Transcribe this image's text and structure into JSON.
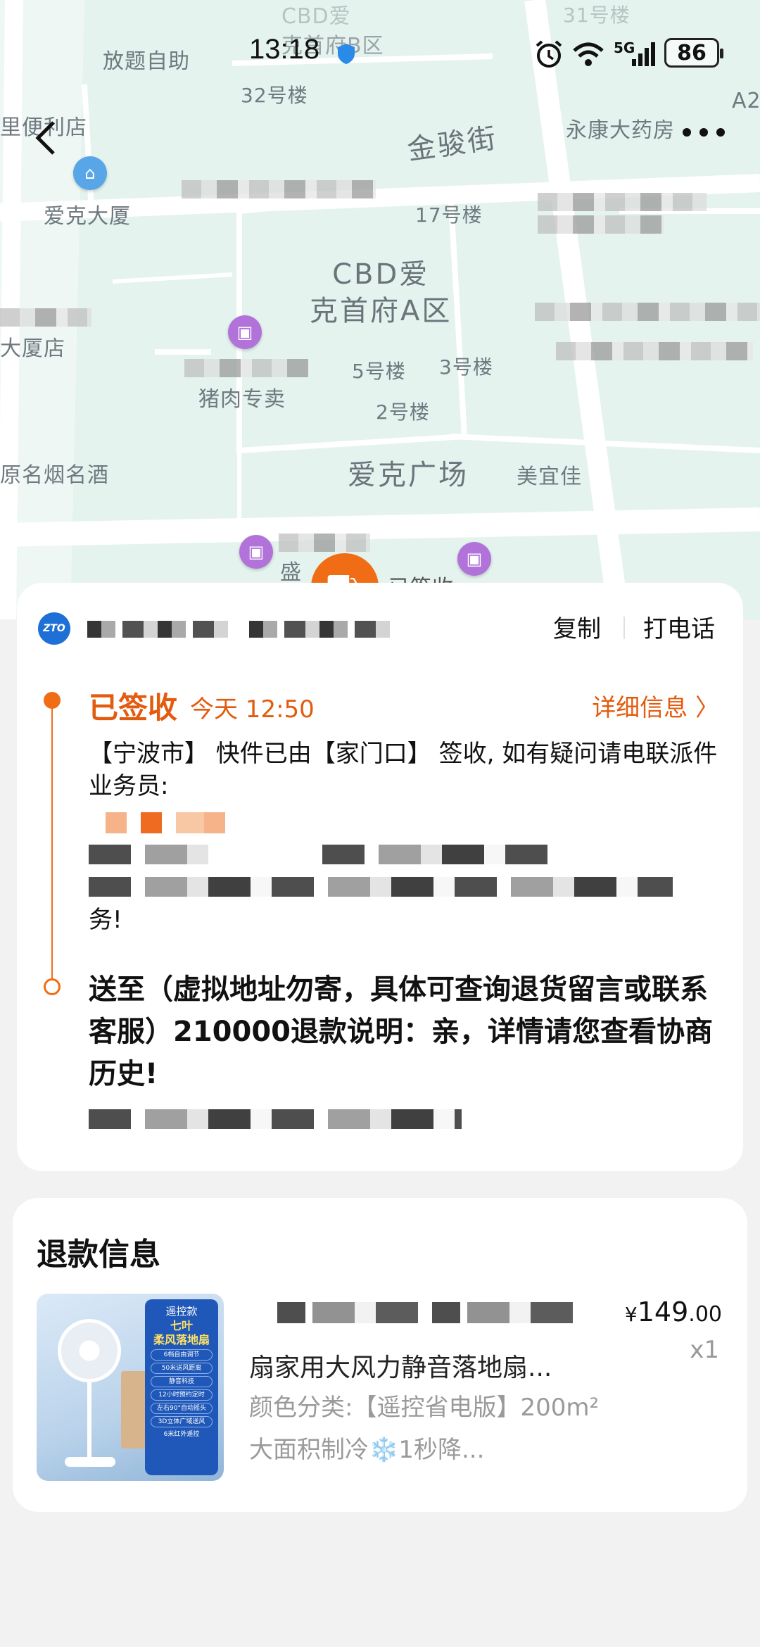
{
  "status_bar": {
    "time": "13:18",
    "network": "5G",
    "battery": "86"
  },
  "map": {
    "labels": {
      "cbd_b": "CBD爱 克首府B区",
      "fangti": "放题自助",
      "bldg32": "32号楼",
      "bldg31": "31号楼",
      "shop": "里便利店",
      "jinjun": "金骏街",
      "yongkang": "永康大药房",
      "a2": "A2",
      "aike": "爱克大厦",
      "bldg17": "17号楼",
      "cbd_a": "CBD爱\n克首府A区",
      "dasha_store": "大厦店",
      "bldg5": "5号楼",
      "bldg3": "3号楼",
      "bldg2": "2号楼",
      "pork": "猪肉专卖",
      "aike_square": "爱克广场",
      "meiyijia": "美宜佳",
      "tobacco": "原名烟名酒",
      "sheng": "盛",
      "sign_partial": "已签收"
    }
  },
  "tracking": {
    "copy_label": "复制",
    "call_label": "打电话",
    "status": "已签收",
    "time": "今天 12:50",
    "detail_link": "详细信息 〉",
    "signed_text": "【宁波市】 快件已由【家门口】 签收, 如有疑问请电联派件业务员:",
    "signed_tail": "务!",
    "address": "送至（虚拟地址勿寄，具体可查询退货留言或联系客服）210000退款说明：亲，详情请您查看协商历史!"
  },
  "refund": {
    "title": "退款信息",
    "product_name": "扇家用大风力静音落地扇...",
    "spec": "颜色分类:【遥控省电版】200m²大面积制冷❄️1秒降...",
    "price_symbol": "¥",
    "price_int": "149",
    "price_dec": ".00",
    "quantity": "x1",
    "thumb": {
      "tag": "遥控款",
      "title": "七叶\n柔风落地扇",
      "features": [
        "6档自由调节",
        "50米送风距离",
        "静音科技",
        "12小时预约定时",
        "左右90°自动摇头",
        "3D立体广域送风"
      ],
      "remote": "6米红外遥控"
    }
  },
  "icons": {
    "back": "chevron-left-icon",
    "more": "more-dots-icon",
    "alarm": "alarm-icon",
    "wifi": "wifi-icon",
    "signal": "signal-icon",
    "courier": "courier-icon"
  },
  "colors": {
    "accent": "#f06d16",
    "accent_text": "#e35b0e",
    "map_bg": "#e4f3ee"
  }
}
